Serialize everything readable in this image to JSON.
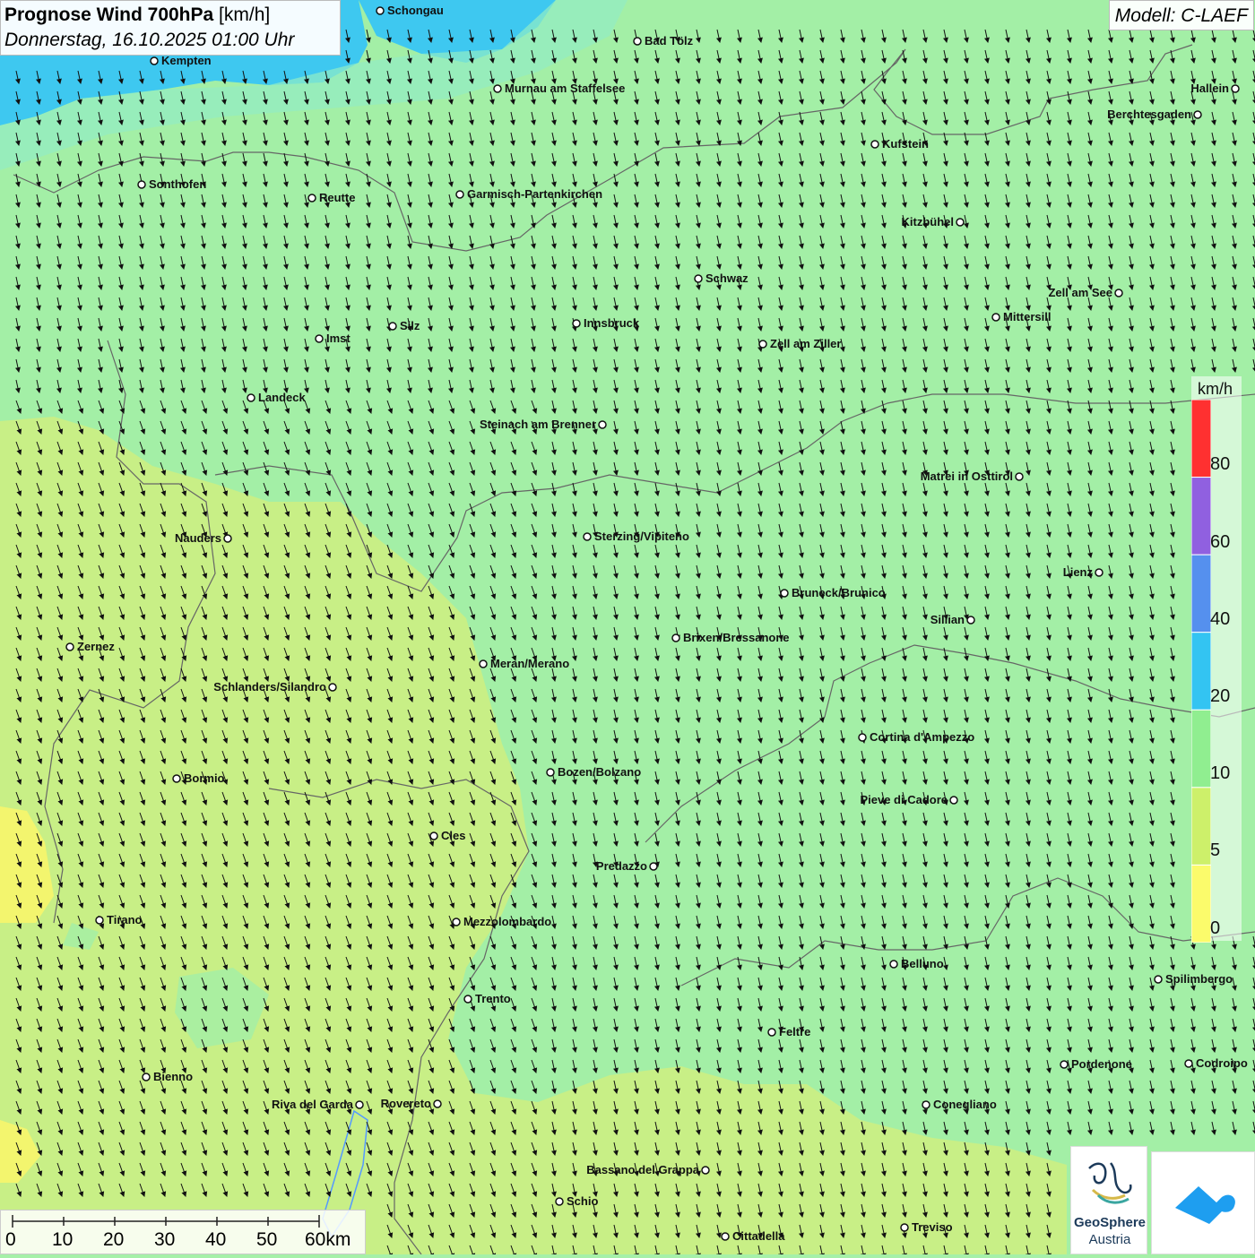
{
  "header": {
    "title_bold": "Prognose Wind 700hPa",
    "title_unit": "[km/h]",
    "datetime": "Donnerstag, 16.10.2025 01:00 Uhr",
    "model": "Modell: C-LAEF"
  },
  "legend": {
    "unit": "km/h",
    "labels": [
      "80",
      "60",
      "40",
      "20",
      "10",
      "5",
      "0"
    ],
    "colors": [
      "#ff3030",
      "#9060e0",
      "#5590ee",
      "#33c4f2",
      "#90ee90",
      "#cdf06a",
      "#fbfb6b"
    ]
  },
  "scale_bar": {
    "labels": [
      "0",
      "10",
      "20",
      "30",
      "40",
      "50",
      "60km"
    ]
  },
  "cities": [
    {
      "name": "Schongau"
    },
    {
      "name": "Bad Tölz"
    },
    {
      "name": "Kempten"
    },
    {
      "name": "Murnau am Staffelsee"
    },
    {
      "name": "Hallein"
    },
    {
      "name": "Berchtesgaden"
    },
    {
      "name": "Kufstein"
    },
    {
      "name": "Sonthofen"
    },
    {
      "name": "Reutte"
    },
    {
      "name": "Garmisch-Partenkirchen"
    },
    {
      "name": "Kitzbühel"
    },
    {
      "name": "Schwaz"
    },
    {
      "name": "Zell am See"
    },
    {
      "name": "Mittersill"
    },
    {
      "name": "Innsbruck"
    },
    {
      "name": "Silz"
    },
    {
      "name": "Imst"
    },
    {
      "name": "Zell am Ziller"
    },
    {
      "name": "Landeck"
    },
    {
      "name": "Steinach am Brenner"
    },
    {
      "name": "Matrei in Osttirol"
    },
    {
      "name": "Nauders"
    },
    {
      "name": "Sterzing/Vipiteno"
    },
    {
      "name": "Lienz"
    },
    {
      "name": "Bruneck/Brunico"
    },
    {
      "name": "Sillian"
    },
    {
      "name": "Zernez"
    },
    {
      "name": "Brixen/Bressanone"
    },
    {
      "name": "Meran/Merano"
    },
    {
      "name": "Schlanders/Silandro"
    },
    {
      "name": "Cortina d'Ampezzo"
    },
    {
      "name": "Bozen/Bolzano"
    },
    {
      "name": "Bormio"
    },
    {
      "name": "Pieve di Cadore"
    },
    {
      "name": "Cles"
    },
    {
      "name": "Predazzo"
    },
    {
      "name": "Tirano"
    },
    {
      "name": "Mezzolombardo"
    },
    {
      "name": "Belluno"
    },
    {
      "name": "Spilimbergo"
    },
    {
      "name": "Trento"
    },
    {
      "name": "Feltre"
    },
    {
      "name": "Pordenone"
    },
    {
      "name": "Codroipo"
    },
    {
      "name": "Bienno"
    },
    {
      "name": "Riva del Garda"
    },
    {
      "name": "Rovereto"
    },
    {
      "name": "Conegliano"
    },
    {
      "name": "Bassano del Grappa"
    },
    {
      "name": "Schio"
    },
    {
      "name": "Treviso"
    },
    {
      "name": "Cittadella"
    }
  ],
  "logos": {
    "geosphere_line1": "GeoSphere",
    "geosphere_line2": "Austria",
    "geosphere_icon": "geosphere-logo-icon",
    "app_icon": "wetter-app-logo-icon"
  }
}
